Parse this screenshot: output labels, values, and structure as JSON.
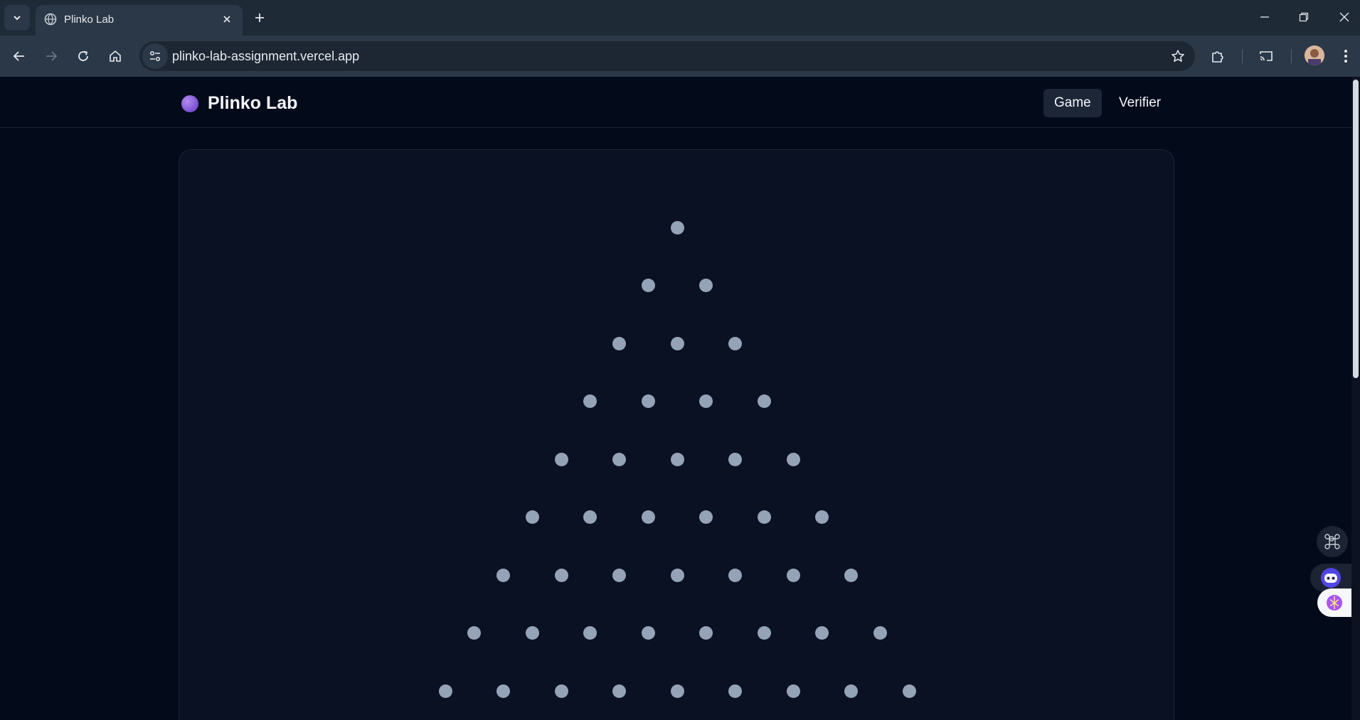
{
  "browser": {
    "tab": {
      "title": "Plinko Lab"
    },
    "address_bar": {
      "url": "plinko-lab-assignment.vercel.app"
    }
  },
  "site": {
    "brand": "Plinko Lab",
    "nav": [
      {
        "label": "Game",
        "active": true
      },
      {
        "label": "Verifier",
        "active": false
      }
    ]
  },
  "board": {
    "peg_rows": [
      1,
      2,
      3,
      4,
      5,
      6,
      7,
      8,
      9
    ],
    "peg_color": "#94a3b8"
  },
  "colors": {
    "page_bg": "#030a1a",
    "board_bg": "#0a1122",
    "logo_accent": "#8b5cf6",
    "chrome_bg": "#2b3847"
  }
}
